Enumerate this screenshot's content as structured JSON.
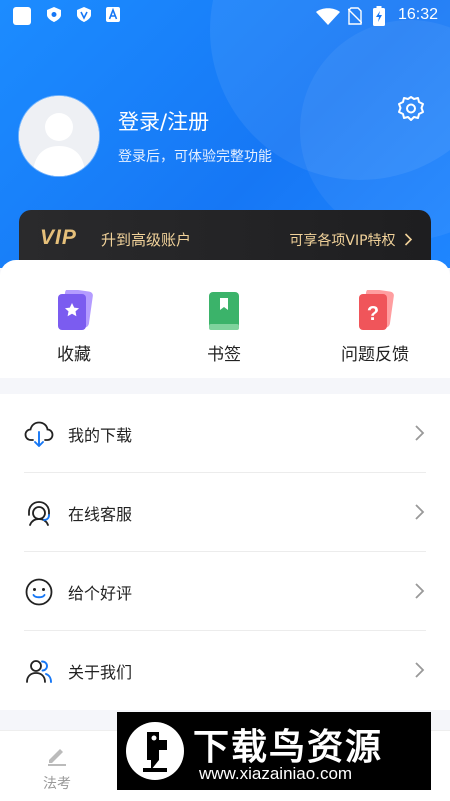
{
  "status_bar": {
    "time": "16:32",
    "icons": [
      "app-icon",
      "shield-icon",
      "shield-icon",
      "text-a-icon",
      "wifi-icon",
      "no-sim-icon",
      "battery-charging-icon"
    ]
  },
  "profile": {
    "title": "登录/注册",
    "subtitle": "登录后，可体验完整功能",
    "avatar_icon": "default-avatar-icon",
    "settings_icon": "gear-icon"
  },
  "vip": {
    "logo": "VIP",
    "text": "升到高级账户",
    "right_text": "可享各项VIP特权"
  },
  "quick_actions": [
    {
      "label": "收藏",
      "icon": "star-card-icon",
      "color": "#7b5cf0"
    },
    {
      "label": "书签",
      "icon": "bookmark-card-icon",
      "color": "#3bb36a"
    },
    {
      "label": "问题反馈",
      "icon": "question-card-icon",
      "color": "#f0555a"
    }
  ],
  "menu": [
    {
      "label": "我的下载",
      "icon": "cloud-download-icon"
    },
    {
      "label": "在线客服",
      "icon": "headset-icon"
    },
    {
      "label": "给个好评",
      "icon": "smile-icon"
    },
    {
      "label": "关于我们",
      "icon": "users-icon"
    }
  ],
  "bottom_nav": {
    "tabs": [
      {
        "label": "法考",
        "icon": "pencil-icon"
      }
    ]
  },
  "watermark": {
    "title": "下载鸟资源",
    "url": "www.xiazainiao.com"
  },
  "colors": {
    "header_blue": "#1677f5",
    "vip_gold": "#e6c07a",
    "vip_bg": "#232325"
  }
}
